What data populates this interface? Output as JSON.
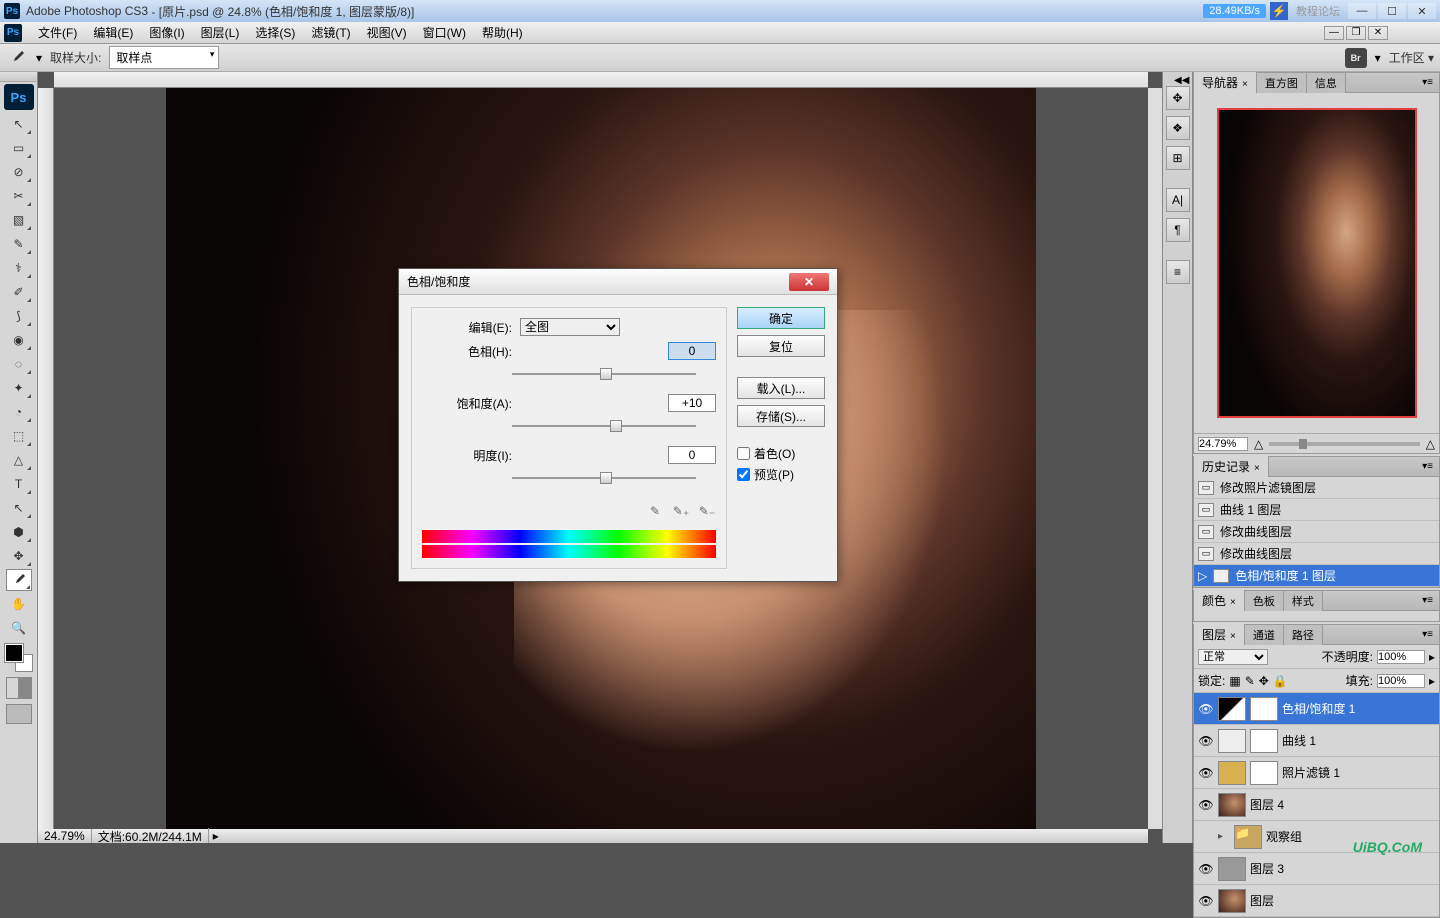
{
  "titlebar": {
    "app": "Adobe Photoshop CS3",
    "doc": "- [原片.psd @ 24.8% (色相/饱和度 1, 图层蒙版/8)]",
    "netspeed": "28.49KB/s",
    "watermark": "教程论坛"
  },
  "menubar": {
    "items": [
      "文件(F)",
      "编辑(E)",
      "图像(I)",
      "图层(L)",
      "选择(S)",
      "滤镜(T)",
      "视图(V)",
      "窗口(W)",
      "帮助(H)"
    ]
  },
  "options": {
    "sample_label": "取样大小:",
    "sample_value": "取样点",
    "workspace": "工作区 ▾"
  },
  "tools": [
    "↖",
    "▭",
    "⊘",
    "✂",
    "▧",
    "✎",
    "⚕",
    "✐",
    "⟆",
    "◉",
    "◌",
    "✦",
    "◔",
    "⬚",
    "△",
    "⬢",
    "T",
    "↖",
    "✥",
    "✋",
    "🔍"
  ],
  "statusbar": {
    "zoom": "24.79%",
    "doc": "文档:60.2M/244.1M"
  },
  "panels": {
    "navigator": {
      "tabs": [
        "导航器",
        "直方图",
        "信息"
      ],
      "zoom": "24.79%"
    },
    "history": {
      "tab": "历史记录",
      "items": [
        {
          "label": "修改照片滤镜图层",
          "selected": false
        },
        {
          "label": "曲线 1 图层",
          "selected": false
        },
        {
          "label": "修改曲线图层",
          "selected": false
        },
        {
          "label": "修改曲线图层",
          "selected": false
        },
        {
          "label": "色相/饱和度 1 图层",
          "selected": true
        }
      ]
    },
    "colors": {
      "tabs": [
        "颜色",
        "色板",
        "样式"
      ]
    },
    "layers": {
      "tabs": [
        "图层",
        "通道",
        "路径"
      ],
      "blend_label": "正常",
      "opacity_label": "不透明度:",
      "opacity_value": "100%",
      "lock_label": "锁定:",
      "fill_label": "填充:",
      "fill_value": "100%",
      "items": [
        {
          "name": "色相/饱和度 1",
          "kind": "adj",
          "mask": true,
          "selected": true
        },
        {
          "name": "曲线 1",
          "kind": "curves",
          "mask": true
        },
        {
          "name": "照片滤镜 1",
          "kind": "adj-y",
          "mask": true
        },
        {
          "name": "图层 4",
          "kind": "img"
        },
        {
          "name": "观察组",
          "kind": "folder"
        },
        {
          "name": "图层 3",
          "kind": "gray"
        },
        {
          "name": "图层",
          "kind": "img"
        }
      ]
    }
  },
  "icondock": [
    "✥",
    "❖",
    "⊞",
    "—",
    "A|",
    "¶",
    "—",
    "≡"
  ],
  "dialog": {
    "title": "色相/饱和度",
    "edit_label": "编辑(E):",
    "edit_value": "全图",
    "hue_label": "色相(H):",
    "hue_value": "0",
    "sat_label": "饱和度(A):",
    "sat_value": "+10",
    "light_label": "明度(I):",
    "light_value": "0",
    "colorize_label": "着色(O)",
    "preview_label": "预览(P)",
    "ok": "确定",
    "reset": "复位",
    "load": "载入(L)...",
    "save": "存储(S)..."
  },
  "watermark_br": "UiBQ.CoM"
}
